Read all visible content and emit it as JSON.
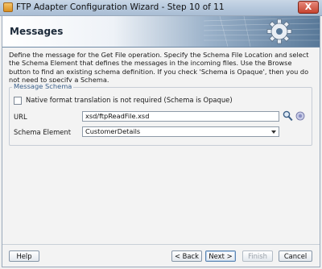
{
  "window": {
    "title": "FTP Adapter Configuration Wizard - Step 10 of 11",
    "close_glyph": "X"
  },
  "banner": {
    "title": "Messages"
  },
  "description": "Define the message for the Get File operation.  Specify the Schema File Location and select the Schema Element that defines the messages in the incoming files. Use the Browse button to find an existing schema definition. If you check 'Schema is Opaque', then you do not need to specify a Schema.",
  "message_schema": {
    "legend": "Message Schema",
    "opaque_checkbox_label": "Native format translation is not required (Schema is Opaque)",
    "opaque_checked": false,
    "url_label": "URL",
    "url_value": "xsd/ftpReadFile.xsd",
    "schema_element_label": "Schema Element",
    "schema_element_value": "CustomerDetails"
  },
  "buttons": {
    "help": "Help",
    "back": "< Back",
    "next": "Next >",
    "finish": "Finish",
    "cancel": "Cancel"
  },
  "icons": {
    "app": "wizard-app-icon",
    "banner": "gear-icon",
    "search": "search-icon",
    "browse": "browse-icon"
  }
}
